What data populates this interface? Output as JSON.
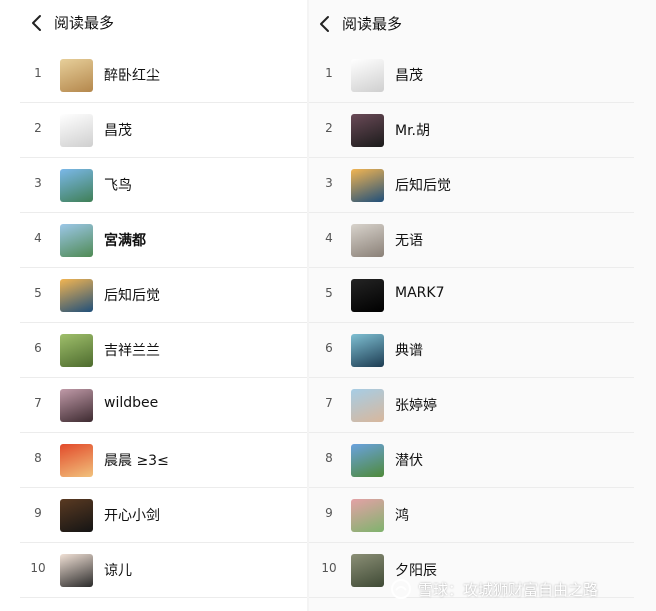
{
  "left": {
    "title": "阅读最多",
    "items": [
      {
        "rank": "1",
        "name": "醉卧红尘",
        "bold": false,
        "avatar": "desert-avatar",
        "colors": [
          "#e7cf9a",
          "#b4874c"
        ]
      },
      {
        "rank": "2",
        "name": "昌茂",
        "bold": false,
        "avatar": "sketch-portrait-avatar",
        "colors": [
          "#ffffff",
          "#cfcfcf"
        ]
      },
      {
        "rank": "3",
        "name": "飞鸟",
        "bold": false,
        "avatar": "waterfall-landscape-avatar",
        "colors": [
          "#7bb8e9",
          "#3f7f56"
        ]
      },
      {
        "rank": "4",
        "name": "宮满都",
        "bold": true,
        "avatar": "karst-mountains-avatar",
        "colors": [
          "#9cc7e8",
          "#4f8a54"
        ]
      },
      {
        "rank": "5",
        "name": "后知后觉",
        "bold": false,
        "avatar": "sunset-dolphin-avatar",
        "colors": [
          "#f2b552",
          "#1f4f7a"
        ]
      },
      {
        "rank": "6",
        "name": "吉祥兰兰",
        "bold": false,
        "avatar": "round-flowers-avatar",
        "colors": [
          "#9fbf6b",
          "#4d6b2e"
        ]
      },
      {
        "rank": "7",
        "name": "wildbee",
        "bold": false,
        "avatar": "pagoda-avatar",
        "colors": [
          "#c09aa8",
          "#3d2a30"
        ]
      },
      {
        "rank": "8",
        "name": "晨晨 ≥3≤",
        "bold": false,
        "avatar": "red-collage-avatar",
        "colors": [
          "#e24a2a",
          "#f1c27d"
        ]
      },
      {
        "rank": "9",
        "name": "开心小剑",
        "bold": false,
        "avatar": "dark-warm-avatar",
        "colors": [
          "#5a3a22",
          "#141414"
        ]
      },
      {
        "rank": "10",
        "name": "谅儿",
        "bold": false,
        "avatar": "woman-portrait-avatar",
        "colors": [
          "#f1e1d6",
          "#2a2a2a"
        ]
      }
    ]
  },
  "right": {
    "title": "阅读最多",
    "items": [
      {
        "rank": "1",
        "name": "昌茂",
        "avatar": "sketch-portrait-avatar",
        "colors": [
          "#ffffff",
          "#cfcfcf"
        ]
      },
      {
        "rank": "2",
        "name": "Mr.胡",
        "avatar": "cartoon-man-avatar",
        "colors": [
          "#6a4a57",
          "#1b1b1b"
        ]
      },
      {
        "rank": "3",
        "name": "后知后觉",
        "avatar": "sunset-dolphin-avatar",
        "colors": [
          "#f2b552",
          "#1f4f7a"
        ]
      },
      {
        "rank": "4",
        "name": "无语",
        "avatar": "interior-avatar",
        "colors": [
          "#d8d3cc",
          "#8a8077"
        ]
      },
      {
        "rank": "5",
        "name": "MARK7",
        "avatar": "dark-jet-avatar",
        "colors": [
          "#242424",
          "#000000"
        ]
      },
      {
        "rank": "6",
        "name": "典谱",
        "avatar": "hat-figure-avatar",
        "colors": [
          "#7fc0d3",
          "#1d3c52"
        ]
      },
      {
        "rank": "7",
        "name": "张婷婷",
        "avatar": "child-photo-avatar",
        "colors": [
          "#a6cde5",
          "#d8b79c"
        ]
      },
      {
        "rank": "8",
        "name": "潜伏",
        "avatar": "sky-field-avatar",
        "colors": [
          "#6aa2df",
          "#4f8a3a"
        ]
      },
      {
        "rank": "9",
        "name": "鸿",
        "avatar": "tulips-avatar",
        "colors": [
          "#e4a1a6",
          "#7fb36d"
        ]
      },
      {
        "rank": "10",
        "name": "夕阳辰",
        "avatar": "forest-avatar",
        "colors": [
          "#8b8f76",
          "#3f4a35"
        ]
      }
    ]
  },
  "watermark": {
    "text": "雪球：攻城狮财富自由之路"
  }
}
